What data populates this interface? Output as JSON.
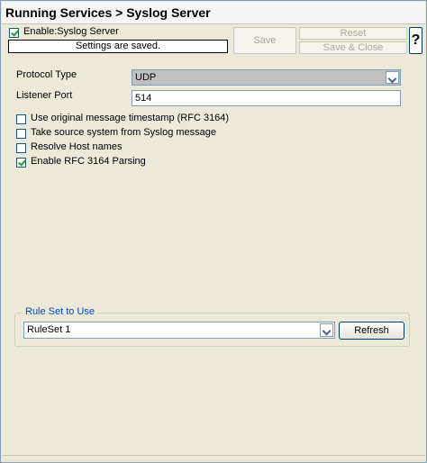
{
  "window": {
    "title": "Running Services > Syslog Server"
  },
  "header": {
    "enable_label": "Enable:Syslog Server",
    "enabled": true,
    "status_text": "Settings are saved.",
    "save_label": "Save",
    "reset_label": "Reset",
    "save_close_label": "Save & Close",
    "help_label": "?"
  },
  "form": {
    "protocol_label": "Protocol Type",
    "protocol_value": "UDP",
    "port_label": "Listener Port",
    "port_value": "514",
    "options": [
      {
        "label": "Use original message timestamp (RFC 3164)",
        "checked": false
      },
      {
        "label": "Take source system from Syslog message",
        "checked": false
      },
      {
        "label": "Resolve Host names",
        "checked": false
      },
      {
        "label": "Enable RFC 3164 Parsing",
        "checked": true
      }
    ]
  },
  "ruleset": {
    "group_label": "Rule Set to Use",
    "value": "RuleSet 1",
    "refresh_label": "Refresh"
  },
  "colors": {
    "legend": "#0046d5",
    "panel_bg": "#ece9d8",
    "check_mark": "#21a121"
  }
}
